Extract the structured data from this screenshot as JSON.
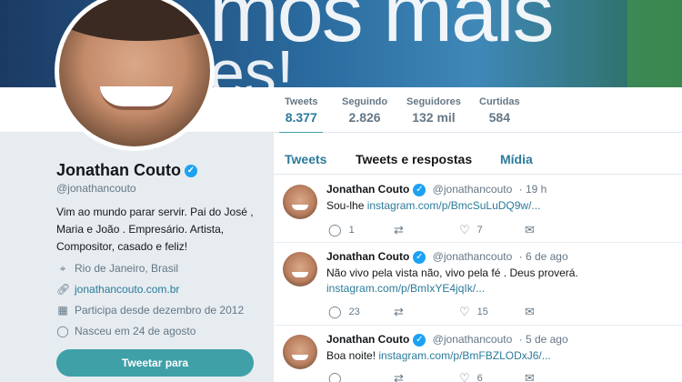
{
  "banner": {
    "text_line1": "mos mais",
    "text_line2": "es!"
  },
  "profile": {
    "name": "Jonathan Couto",
    "handle": "@jonathancouto",
    "bio": "Vim ao mundo parar servir. Pai do José , Maria e João . Empresário. Artista, Compositor, casado e feliz!",
    "location": "Rio de Janeiro, Brasil",
    "website": "jonathancouto.com.br",
    "joined": "Participa desde dezembro de 2012",
    "birthday": "Nasceu em 24 de agosto",
    "tweet_to_label": "Tweetar para"
  },
  "stats": [
    {
      "label": "Tweets",
      "value": "8.377"
    },
    {
      "label": "Seguindo",
      "value": "2.826"
    },
    {
      "label": "Seguidores",
      "value": "132 mil"
    },
    {
      "label": "Curtidas",
      "value": "584"
    }
  ],
  "tabs": [
    "Tweets",
    "Tweets e respostas",
    "Mídia"
  ],
  "tweets": [
    {
      "name": "Jonathan Couto",
      "handle": "@jonathancouto",
      "time": "· 19 h",
      "text_pre": "Sou-lhe ",
      "link": "instagram.com/p/BmcSuLuDQ9w/...",
      "replies": "1",
      "retweets": "",
      "likes": "7"
    },
    {
      "name": "Jonathan Couto",
      "handle": "@jonathancouto",
      "time": "· 6 de ago",
      "text_pre": "Não vivo pela vista não, vivo pela fé . Deus proverá.",
      "link": "instagram.com/p/BmIxYE4jqIk/...",
      "replies": "23",
      "retweets": "",
      "likes": "15"
    },
    {
      "name": "Jonathan Couto",
      "handle": "@jonathancouto",
      "time": "· 5 de ago",
      "text_pre": "Boa noite! ",
      "link": "instagram.com/p/BmFBZLODxJ6/...",
      "replies": "",
      "retweets": "",
      "likes": "6"
    }
  ],
  "colors": {
    "accent": "#3fa0a8",
    "link": "#2b7a9a",
    "verified": "#1da1f2"
  },
  "icons": {
    "location": "map-pin-icon",
    "website": "link-icon",
    "joined": "calendar-icon",
    "birthday": "balloon-icon",
    "reply": "reply-icon",
    "retweet": "retweet-icon",
    "like": "heart-icon",
    "message": "envelope-icon"
  }
}
